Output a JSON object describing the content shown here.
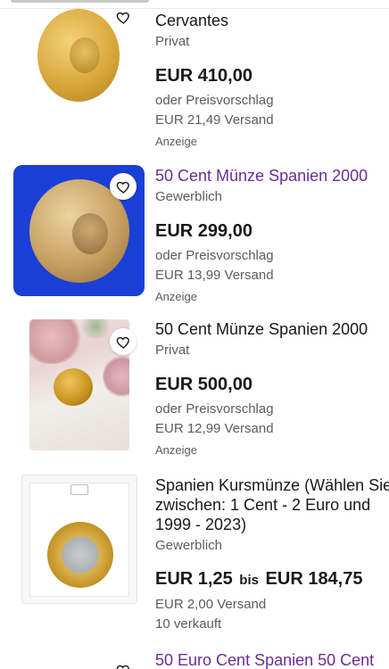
{
  "listings": [
    {
      "title": "Cervantes",
      "seller": "Privat",
      "price": "EUR 410,00",
      "offer": "oder Preisvorschlag",
      "shipping": "EUR 21,49 Versand",
      "ad_label": "Anzeige",
      "image_desc": "50-cent-coin-cervantes"
    },
    {
      "title": "50 Cent Münze Spanien 2000",
      "seller": "Gewerblich",
      "price": "EUR 299,00",
      "offer": "oder Preisvorschlag",
      "shipping": "EUR 13,99 Versand",
      "ad_label": "Anzeige"
    },
    {
      "title": "50 Cent Münze Spanien 2000",
      "seller": "Privat",
      "price": "EUR 500,00",
      "offer": "oder Preisvorschlag",
      "shipping": "EUR 12,99 Versand",
      "ad_label": "Anzeige"
    },
    {
      "title": "Spanien Kursmünze (Wählen Sie zwischen: 1 Cent - 2 Euro und 1999 - 2023)",
      "seller": "Gewerblich",
      "price_from": "EUR 1,25",
      "price_sep": "bis",
      "price_to": "EUR 184,75",
      "shipping": "EUR 2,00 Versand",
      "sold": "10 verkauft"
    },
    {
      "title": "50 Euro Cent Spanien 50 Cent"
    }
  ],
  "colors": {
    "visited_title": "#6b2c95",
    "text": "#191919",
    "secondary": "#5c5c5c",
    "blue_bg": "#1a3fd6"
  },
  "icons": {
    "watch": "heart-icon"
  }
}
